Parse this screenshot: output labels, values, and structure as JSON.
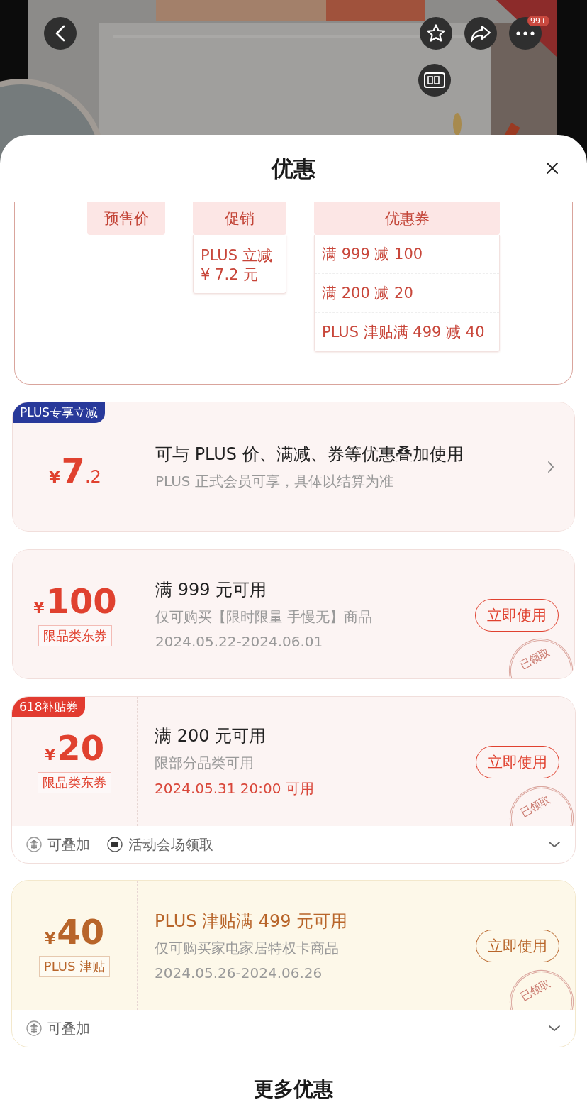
{
  "header": {
    "badge": "99+"
  },
  "sheet": {
    "title": "优惠"
  },
  "structure": {
    "columns": [
      {
        "heading": "预售价"
      },
      {
        "heading": "促销",
        "items": [
          {
            "lines": [
              "PLUS 立减",
              "¥ 7.2 元"
            ]
          }
        ]
      },
      {
        "heading": "优惠券",
        "items": [
          {
            "lines": [
              "满 999 减 100"
            ]
          },
          {
            "lines": [
              "满 200 减 20"
            ]
          },
          {
            "lines": [
              "PLUS 津贴满 499 减 40"
            ]
          }
        ]
      }
    ]
  },
  "cards": [
    {
      "kind": "plus",
      "color": "#e0412f",
      "tag": {
        "text": "PLUS专享立减",
        "color": "#28399a"
      },
      "currency": "¥",
      "amount": "7",
      "decimal": ".2",
      "title": "可与 PLUS 价、满减、券等优惠叠加使用",
      "subtitle": "PLUS 正式会员可享，具体以结算为准"
    },
    {
      "kind": "coupon",
      "color": "#e0412f",
      "currency": "¥",
      "amount": "100",
      "label": "限品类东券",
      "title": "满 999 元可用",
      "lines": [
        {
          "text": "仅可购买【限时限量 手慢无】商品",
          "highlight": false
        },
        {
          "text": "2024.05.22-2024.06.01",
          "highlight": false
        }
      ],
      "button": "立即使用",
      "stamp": "已领取"
    },
    {
      "kind": "coupon",
      "color": "#e0412f",
      "tag": {
        "text": "618补贴券",
        "color": "#e23b30"
      },
      "currency": "¥",
      "amount": "20",
      "label": "限品类东券",
      "title": "满 200 元可用",
      "lines": [
        {
          "text": "限部分品类可用",
          "highlight": false
        },
        {
          "text": "2024.05.31 20:00 可用",
          "highlight": true
        }
      ],
      "button": "立即使用",
      "stamp": "已领取",
      "footer": [
        {
          "kind": "stack",
          "text": "可叠加"
        },
        {
          "kind": "ticket",
          "text": "活动会场领取"
        }
      ]
    },
    {
      "kind": "allowance",
      "color": "#b8652a",
      "currency": "¥",
      "amount": "40",
      "label": "PLUS 津贴",
      "title": "PLUS 津贴满 499 元可用",
      "lines": [
        {
          "text": "仅可购买家电家居特权卡商品",
          "highlight": false
        },
        {
          "text": "2024.05.26-2024.06.26",
          "highlight": false
        }
      ],
      "button": "立即使用",
      "stamp": "已领取",
      "footer": [
        {
          "kind": "stack",
          "text": "可叠加"
        }
      ]
    }
  ],
  "more": "更多优惠"
}
